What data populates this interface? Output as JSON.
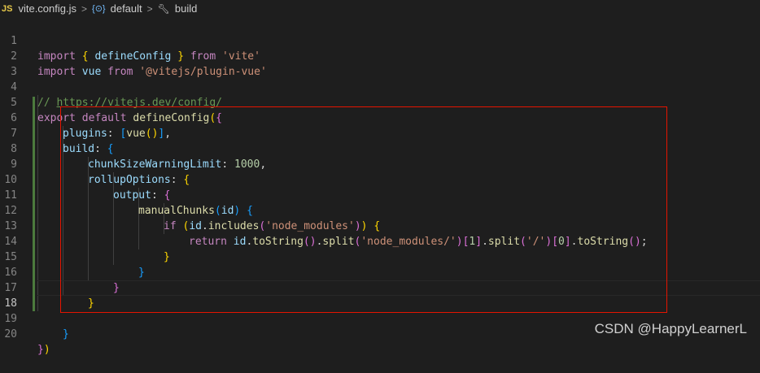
{
  "breadcrumb": {
    "file_badge": "JS",
    "file": "vite.config.js",
    "sep": ">",
    "symbol1": "default",
    "symbol2": "build"
  },
  "line_numbers": [
    "1",
    "2",
    "3",
    "4",
    "5",
    "6",
    "7",
    "8",
    "9",
    "10",
    "11",
    "12",
    "13",
    "14",
    "15",
    "16",
    "17",
    "18",
    "19",
    "20"
  ],
  "code": {
    "l1": [
      "import",
      " ",
      "{",
      " defineConfig ",
      "}",
      " from ",
      "'vite'"
    ],
    "l2": [
      "import",
      " vue ",
      "from",
      " ",
      "'@vitejs/plugin-vue'"
    ],
    "l4": [
      "// ",
      "https://vitejs.dev/config/"
    ],
    "l5": [
      "export",
      " ",
      "default",
      " ",
      "defineConfig",
      "(",
      "{"
    ],
    "l6": [
      "plugins",
      ": ",
      "[",
      "vue",
      "(",
      ")",
      "]",
      ","
    ],
    "l7": [
      "build",
      ": ",
      "{"
    ],
    "l8": [
      "chunkSizeWarningLimit",
      ": ",
      "1000",
      ","
    ],
    "l9": [
      "rollupOptions",
      ": ",
      "{"
    ],
    "l10": [
      "output",
      ": ",
      "{"
    ],
    "l11": [
      "manualChunks",
      "(",
      "id",
      ") ",
      "{"
    ],
    "l12": [
      "if",
      " ",
      "(",
      "id",
      ".",
      "includes",
      "(",
      "'node_modules'",
      ")",
      ")",
      " ",
      "{"
    ],
    "l13": [
      "return",
      " ",
      "id",
      ".",
      "toString",
      "(",
      ")",
      ".",
      "split",
      "(",
      "'node_modules/'",
      ")",
      "[",
      "1",
      "]",
      ".",
      "split",
      "(",
      "'/'",
      ")",
      "[",
      "0",
      "]",
      ".",
      "toString",
      "(",
      ")",
      ";"
    ],
    "l14": [
      "}"
    ],
    "l15": [
      "}"
    ],
    "l16": [
      "}"
    ],
    "l17": [
      "}"
    ],
    "l19": [
      "}"
    ],
    "l20": [
      "}",
      ")"
    ]
  },
  "watermark": "CSDN @HappyLearnerL",
  "colors": {
    "background": "#1e1e1e",
    "keyword": "#c586c0",
    "function": "#dcdcaa",
    "variable": "#9cdcfe",
    "string": "#ce9178",
    "comment": "#6a9955",
    "highlight_box": "#e51400"
  }
}
